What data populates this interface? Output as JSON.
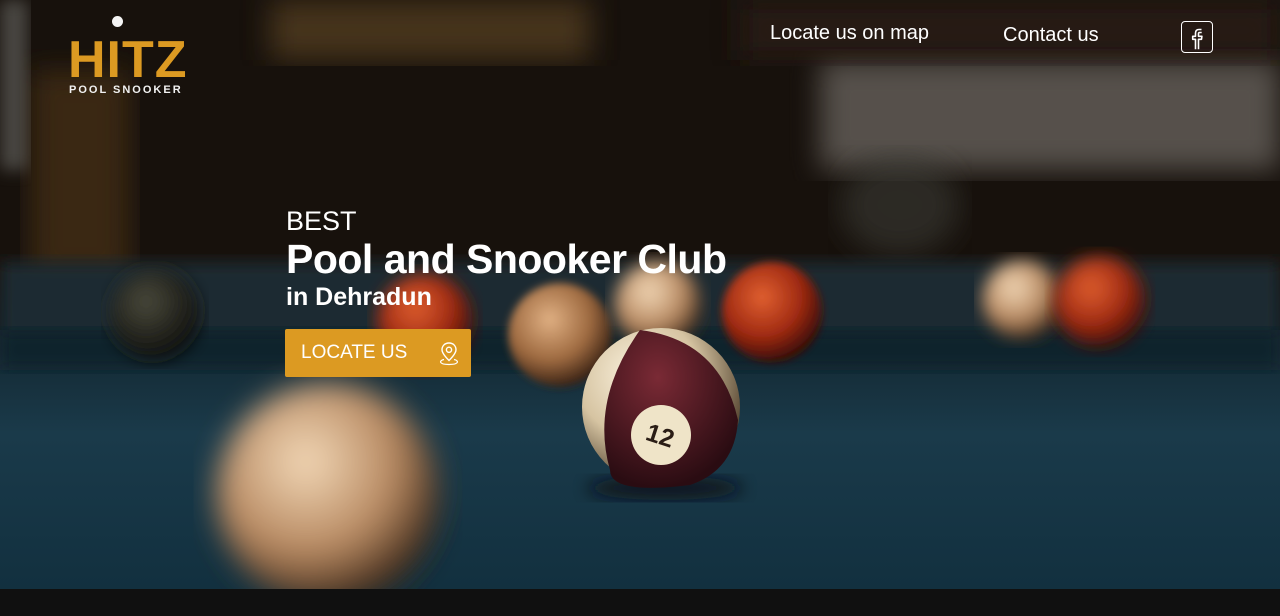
{
  "brand": {
    "logo_main": "HITZ",
    "logo_sub": "POOL SNOOKER"
  },
  "nav": {
    "map_link": "Locate us on map",
    "contact_link": "Contact us",
    "social_icon": "facebook-icon"
  },
  "hero": {
    "kicker": "BEST",
    "headline": "Pool and Snooker Club",
    "location": "in Dehradun",
    "cta_label": "LOCATE US",
    "cta_icon": "map-pin-icon",
    "ball_number": "12"
  },
  "colors": {
    "accent": "#dc9a22",
    "text": "#ffffff",
    "footer_strip": "#101010"
  }
}
